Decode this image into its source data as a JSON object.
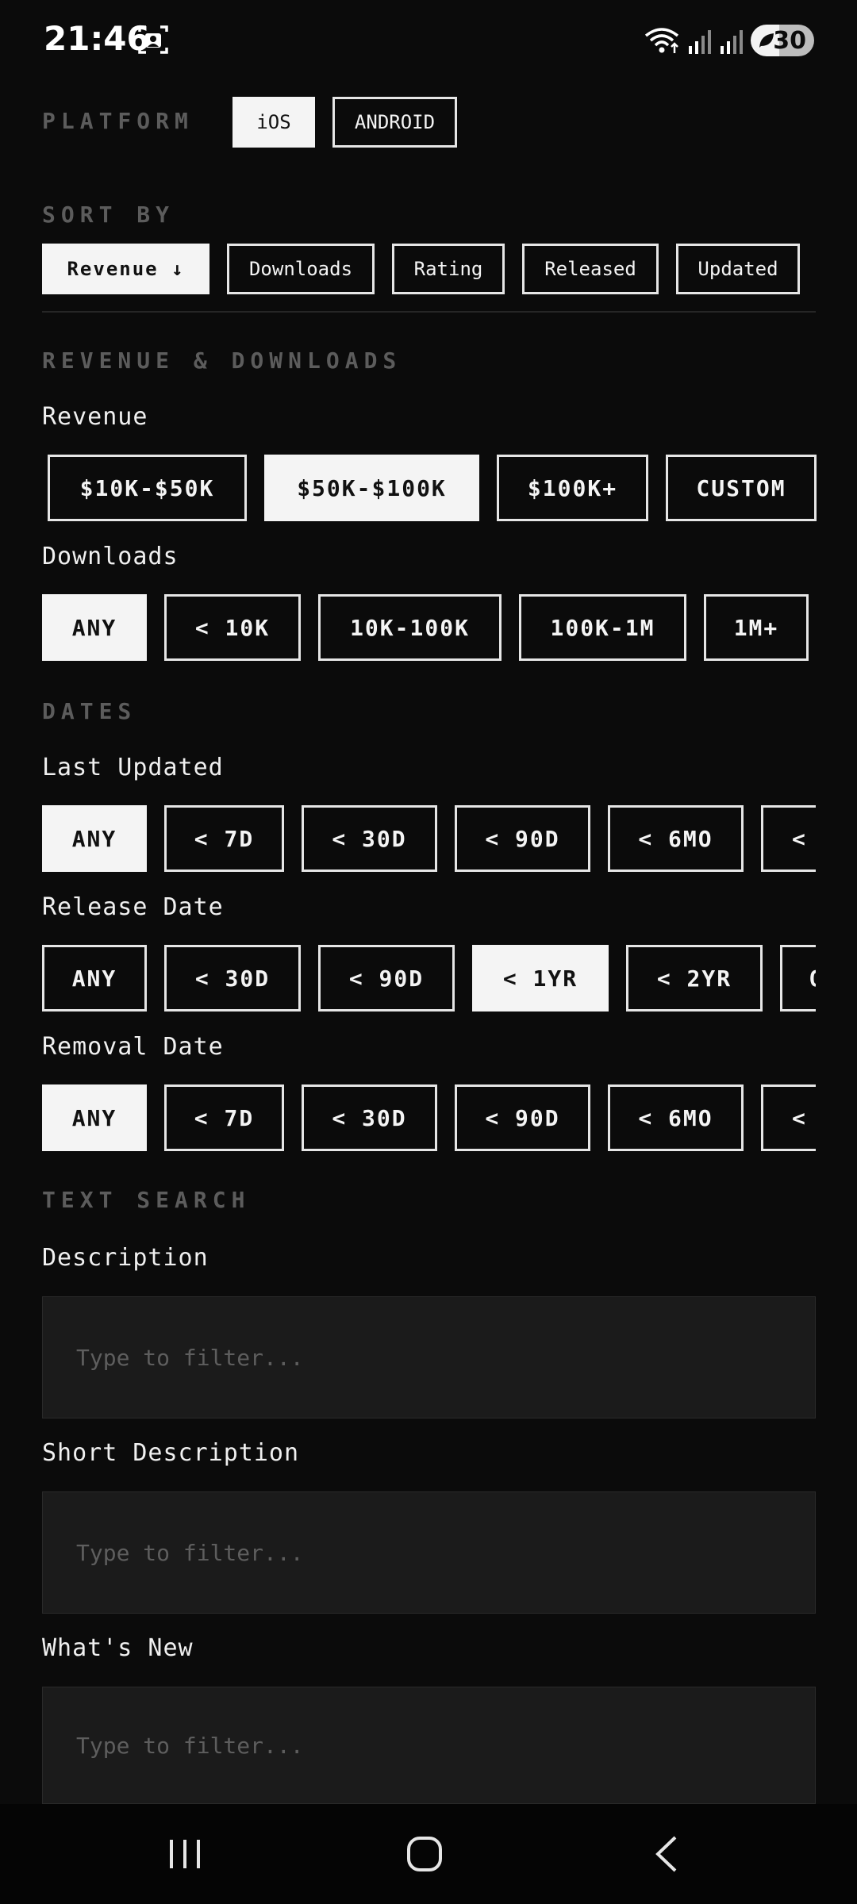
{
  "status": {
    "time": "21:46",
    "battery": "30"
  },
  "platform": {
    "title": "PLATFORM",
    "options": [
      "iOS",
      "ANDROID"
    ],
    "selected": "iOS"
  },
  "sort": {
    "title": "SORT BY",
    "options": [
      "Revenue ↓",
      "Downloads",
      "Rating",
      "Released",
      "Updated"
    ],
    "selected": "Revenue ↓"
  },
  "revenue_downloads": {
    "title": "REVENUE & DOWNLOADS",
    "revenue_label": "Revenue",
    "revenue_options": [
      "$10K-$50K",
      "$50K-$100K",
      "$100K+",
      "CUSTOM"
    ],
    "revenue_selected": "$50K-$100K",
    "downloads_label": "Downloads",
    "downloads_options": [
      "ANY",
      "< 10K",
      "10K-100K",
      "100K-1M",
      "1M+"
    ],
    "downloads_selected": "ANY"
  },
  "dates": {
    "title": "DATES",
    "last_updated_label": "Last Updated",
    "last_updated_options": [
      "ANY",
      "< 7D",
      "< 30D",
      "< 90D",
      "< 6MO",
      "<"
    ],
    "last_updated_selected": "ANY",
    "release_label": "Release Date",
    "release_options": [
      "ANY",
      "< 30D",
      "< 90D",
      "< 1YR",
      "< 2YR",
      "O"
    ],
    "release_selected": "< 1YR",
    "removal_label": "Removal Date",
    "removal_options": [
      "ANY",
      "< 7D",
      "< 30D",
      "< 90D",
      "< 6MO",
      "<"
    ],
    "removal_selected": "ANY"
  },
  "text_search": {
    "title": "TEXT SEARCH",
    "fields": [
      {
        "label": "Description",
        "placeholder": "Type to filter..."
      },
      {
        "label": "Short Description",
        "placeholder": "Type to filter..."
      },
      {
        "label": "What's New",
        "placeholder": "Type to filter..."
      }
    ]
  },
  "nav": {
    "icons": [
      "recent-apps-icon",
      "home-icon",
      "back-icon"
    ]
  }
}
